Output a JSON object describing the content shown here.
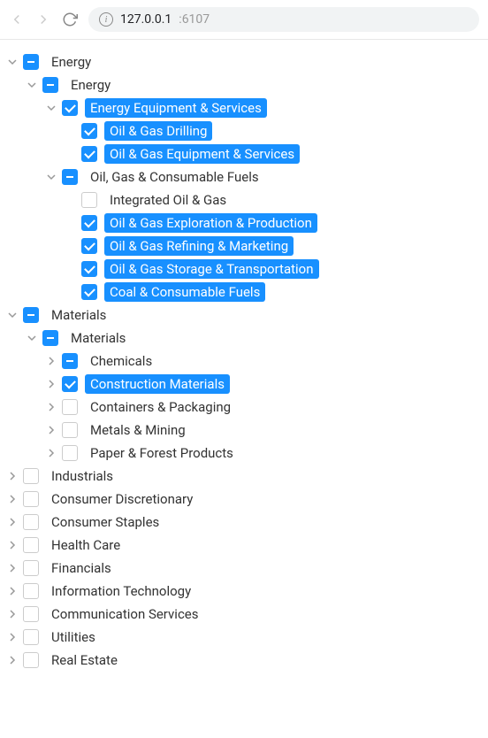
{
  "browser": {
    "url_host": "127.0.0.1",
    "url_port": ":6107"
  },
  "tree": [
    {
      "label": "Energy",
      "state": "indeterminate",
      "selected": false,
      "expanded": true,
      "hasChildren": true,
      "children": [
        {
          "label": "Energy",
          "state": "indeterminate",
          "selected": false,
          "expanded": true,
          "hasChildren": true,
          "children": [
            {
              "label": "Energy Equipment & Services",
              "state": "checked",
              "selected": true,
              "expanded": true,
              "hasChildren": true,
              "children": [
                {
                  "label": "Oil & Gas Drilling",
                  "state": "checked",
                  "selected": true,
                  "expanded": false,
                  "hasChildren": false,
                  "children": []
                },
                {
                  "label": "Oil & Gas Equipment & Services",
                  "state": "checked",
                  "selected": true,
                  "expanded": false,
                  "hasChildren": false,
                  "children": []
                }
              ]
            },
            {
              "label": "Oil, Gas & Consumable Fuels",
              "state": "indeterminate",
              "selected": false,
              "expanded": true,
              "hasChildren": true,
              "children": [
                {
                  "label": "Integrated Oil & Gas",
                  "state": "unchecked",
                  "selected": false,
                  "expanded": false,
                  "hasChildren": false,
                  "children": []
                },
                {
                  "label": "Oil & Gas Exploration & Production",
                  "state": "checked",
                  "selected": true,
                  "expanded": false,
                  "hasChildren": false,
                  "children": []
                },
                {
                  "label": "Oil & Gas Refining & Marketing",
                  "state": "checked",
                  "selected": true,
                  "expanded": false,
                  "hasChildren": false,
                  "children": []
                },
                {
                  "label": "Oil & Gas Storage & Transportation",
                  "state": "checked",
                  "selected": true,
                  "expanded": false,
                  "hasChildren": false,
                  "children": []
                },
                {
                  "label": "Coal & Consumable Fuels",
                  "state": "checked",
                  "selected": true,
                  "expanded": false,
                  "hasChildren": false,
                  "children": []
                }
              ]
            }
          ]
        }
      ]
    },
    {
      "label": "Materials",
      "state": "indeterminate",
      "selected": false,
      "expanded": true,
      "hasChildren": true,
      "children": [
        {
          "label": "Materials",
          "state": "indeterminate",
          "selected": false,
          "expanded": true,
          "hasChildren": true,
          "children": [
            {
              "label": "Chemicals",
              "state": "indeterminate",
              "selected": false,
              "expanded": false,
              "hasChildren": true,
              "children": []
            },
            {
              "label": "Construction Materials",
              "state": "checked",
              "selected": true,
              "expanded": false,
              "hasChildren": true,
              "children": []
            },
            {
              "label": "Containers & Packaging",
              "state": "unchecked",
              "selected": false,
              "expanded": false,
              "hasChildren": true,
              "children": []
            },
            {
              "label": "Metals & Mining",
              "state": "unchecked",
              "selected": false,
              "expanded": false,
              "hasChildren": true,
              "children": []
            },
            {
              "label": "Paper & Forest Products",
              "state": "unchecked",
              "selected": false,
              "expanded": false,
              "hasChildren": true,
              "children": []
            }
          ]
        }
      ]
    },
    {
      "label": "Industrials",
      "state": "unchecked",
      "selected": false,
      "expanded": false,
      "hasChildren": true,
      "children": []
    },
    {
      "label": "Consumer Discretionary",
      "state": "unchecked",
      "selected": false,
      "expanded": false,
      "hasChildren": true,
      "children": []
    },
    {
      "label": "Consumer Staples",
      "state": "unchecked",
      "selected": false,
      "expanded": false,
      "hasChildren": true,
      "children": []
    },
    {
      "label": "Health Care",
      "state": "unchecked",
      "selected": false,
      "expanded": false,
      "hasChildren": true,
      "children": []
    },
    {
      "label": "Financials",
      "state": "unchecked",
      "selected": false,
      "expanded": false,
      "hasChildren": true,
      "children": []
    },
    {
      "label": "Information Technology",
      "state": "unchecked",
      "selected": false,
      "expanded": false,
      "hasChildren": true,
      "children": []
    },
    {
      "label": "Communication Services",
      "state": "unchecked",
      "selected": false,
      "expanded": false,
      "hasChildren": true,
      "children": []
    },
    {
      "label": "Utilities",
      "state": "unchecked",
      "selected": false,
      "expanded": false,
      "hasChildren": true,
      "children": []
    },
    {
      "label": "Real Estate",
      "state": "unchecked",
      "selected": false,
      "expanded": false,
      "hasChildren": true,
      "children": []
    }
  ]
}
